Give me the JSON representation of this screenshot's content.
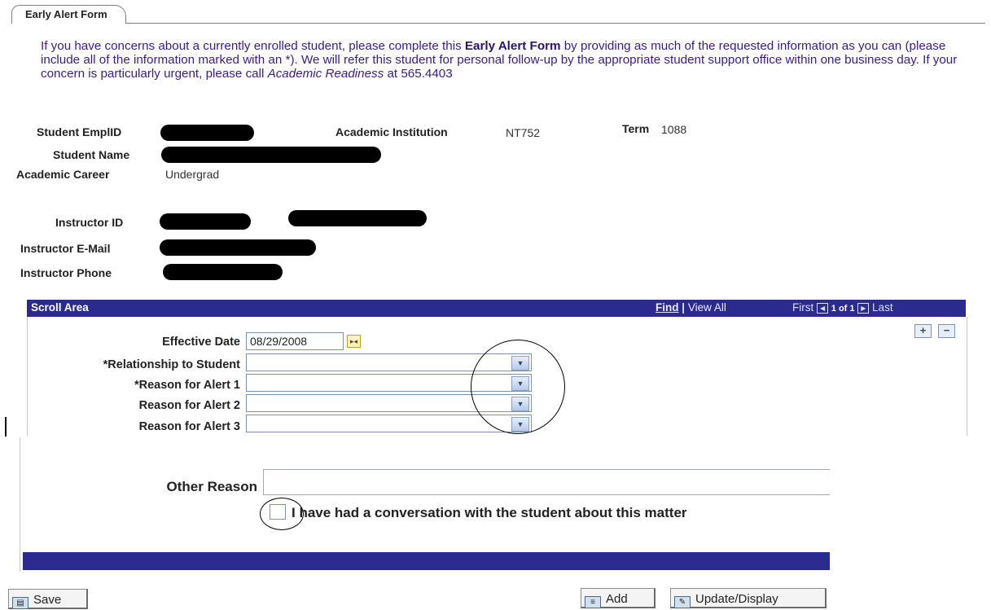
{
  "tab": {
    "label": "Early Alert Form"
  },
  "intro": {
    "p1": "If you have concerns about a currently enrolled student, please complete this ",
    "bold": "Early Alert Form",
    "p2": " by providing as much of the requested information as you can (please include all of the information marked with an *). We will refer this student for personal follow-up by the appropriate student support office within one business day. If your concern is particularly urgent, please call ",
    "italic": "Academic Readiness",
    "p3": " at 565.4403"
  },
  "student": {
    "emplid_label": "Student EmplID",
    "institution_label": "Academic Institution",
    "institution_value": "NT752",
    "term_label": "Term",
    "term_value": "1088",
    "name_label": "Student Name",
    "career_label": "Academic Career",
    "career_value": "Undergrad"
  },
  "instructor": {
    "id_label": "Instructor ID",
    "email_label": "Instructor E-Mail",
    "phone_label": "Instructor Phone"
  },
  "scroll": {
    "title": "Scroll Area",
    "find": "Find",
    "sep": "|",
    "view_all": "View All",
    "first": "First",
    "of_text": "1 of 1",
    "last": "Last",
    "add_row": "+",
    "delete_row": "−"
  },
  "form": {
    "effective_date_label": "Effective Date",
    "effective_date_value": "08/29/2008",
    "relationship_label": "*Relationship to Student",
    "reason1_label": "*Reason for Alert 1",
    "reason2_label": "Reason for Alert 2",
    "reason3_label": "Reason for Alert 3",
    "other_reason_label": "Other Reason",
    "conversation_label": "I have had a conversation with the student about this matter",
    "conversation_checked": false
  },
  "buttons": {
    "save": "Save",
    "add": "Add",
    "update_display": "Update/Display"
  },
  "colors": {
    "intro_text": "#3a1c8c",
    "scroll_header": "#2b2b8f",
    "field_border": "#7c93b4"
  },
  "icons": [
    "calendar-icon",
    "dropdown-arrow-icon",
    "prev-icon",
    "next-icon",
    "save-icon",
    "add-icon",
    "update-display-icon"
  ]
}
